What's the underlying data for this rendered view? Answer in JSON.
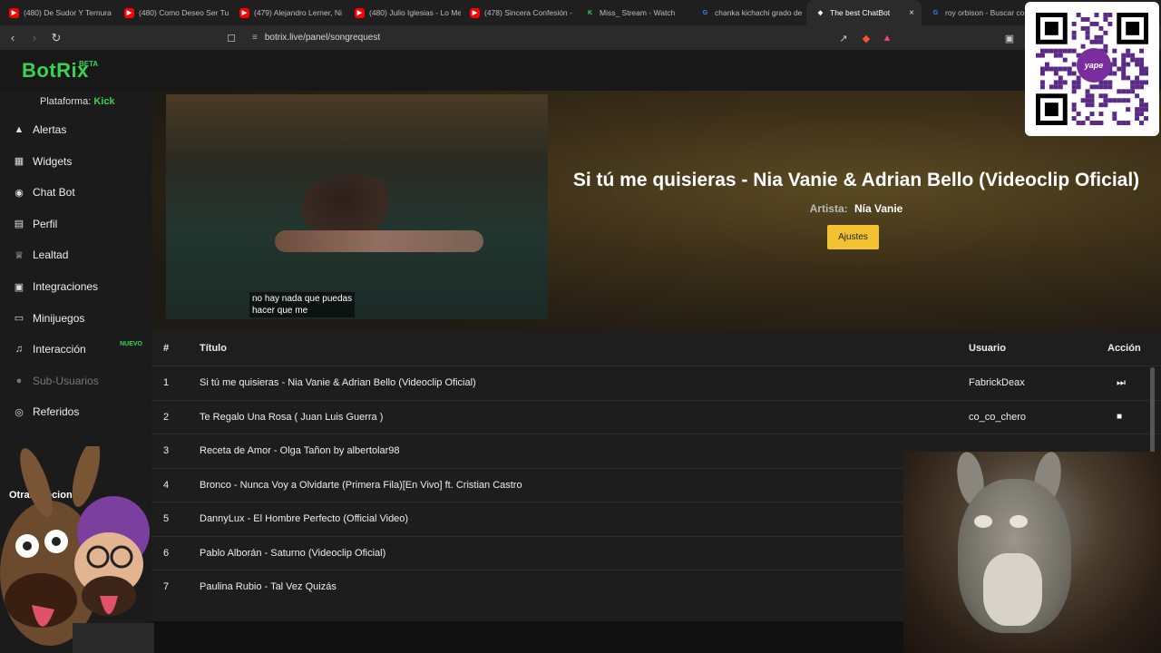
{
  "browser": {
    "tabs": [
      {
        "title": "(480) De Sudor Y Ternura",
        "favicon": "youtube-icon",
        "color": "#ff0000"
      },
      {
        "title": "(480) Como Deseo Ser Tu",
        "favicon": "youtube-icon",
        "color": "#ff0000"
      },
      {
        "title": "(479) Alejandro Lerner, Ni",
        "favicon": "youtube-icon",
        "color": "#ff0000"
      },
      {
        "title": "(480) Julio Iglesias - Lo Me",
        "favicon": "youtube-icon",
        "color": "#ff0000"
      },
      {
        "title": "(478) Sincera Confesión -",
        "favicon": "youtube-icon",
        "color": "#ff0000"
      },
      {
        "title": "Miss_ Stream - Watch",
        "favicon": "kick-icon",
        "color": "#39d353"
      },
      {
        "title": "chanka kichachi grado de",
        "favicon": "google-icon",
        "color": "#4285f4"
      },
      {
        "title": "The best ChatBot",
        "favicon": "botrix-icon",
        "color": "#ffffff",
        "active": true
      },
      {
        "title": "roy orbison - Buscar con",
        "favicon": "google-icon",
        "color": "#4285f4"
      }
    ],
    "url": "botrix.live/panel/songrequest"
  },
  "app": {
    "logo": "BotRix",
    "logo_badge": "BETA",
    "platform_label": "Plataforma:",
    "platform_value": "Kick",
    "accent": "#39d353",
    "nav": [
      {
        "label": "Alertas",
        "icon": "warning-icon"
      },
      {
        "label": "Widgets",
        "icon": "grid-icon"
      },
      {
        "label": "Chat Bot",
        "icon": "robot-icon"
      },
      {
        "label": "Perfil",
        "icon": "id-card-icon"
      },
      {
        "label": "Lealtad",
        "icon": "trophy-icon"
      },
      {
        "label": "Integraciones",
        "icon": "plug-icon"
      },
      {
        "label": "Minijuegos",
        "icon": "gamepad-icon"
      },
      {
        "label": "Interacción",
        "icon": "music-icon",
        "badge": "NUEVO"
      },
      {
        "label": "Sub-Usuarios",
        "icon": "users-icon",
        "disabled": true
      },
      {
        "label": "Referidos",
        "icon": "user-plus-icon"
      }
    ],
    "other_options": "Otras Opciones",
    "other_sub": "D"
  },
  "player": {
    "song_title": "Si tú me quisieras - Nia Vanie & Adrian Bello (Videoclip Oficial)",
    "artist_label": "Artista:",
    "artist": "Nía Vanie",
    "settings_button": "Ajustes",
    "subtitle": "no hay nada que puedas\nhacer que me"
  },
  "queue": {
    "headers": {
      "num": "#",
      "title": "Título",
      "user": "Usuario",
      "action": "Acción"
    },
    "rows": [
      {
        "num": "1",
        "title": "Si tú me quisieras - Nia Vanie & Adrian Bello (Videoclip Oficial)",
        "user": "FabrickDeax",
        "action": "skip-icon"
      },
      {
        "num": "2",
        "title": "Te Regalo Una Rosa ( Juan Luis Guerra )",
        "user": "co_co_chero",
        "action": "trash-icon"
      },
      {
        "num": "3",
        "title": "Receta de Amor - Olga Tañon by albertolar98",
        "user": "",
        "action": ""
      },
      {
        "num": "4",
        "title": "Bronco - Nunca Voy a Olvidarte (Primera Fila)[En Vivo] ft. Cristian Castro",
        "user": "",
        "action": ""
      },
      {
        "num": "5",
        "title": "DannyLux - El Hombre Perfecto (Official Video)",
        "user": "",
        "action": ""
      },
      {
        "num": "6",
        "title": "Pablo Alborán - Saturno (Videoclip Oficial)",
        "user": "",
        "action": ""
      },
      {
        "num": "7",
        "title": "Paulina Rubio - Tal Vez Quizás",
        "user": "",
        "action": ""
      }
    ]
  },
  "overlay": {
    "qr_brand": "yape",
    "qr_badge": "S/"
  }
}
